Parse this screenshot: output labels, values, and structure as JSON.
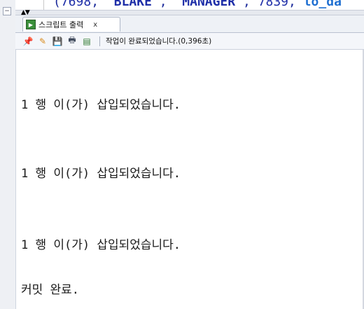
{
  "editor": {
    "code_open": "(",
    "code_num1": "7698",
    "code_str1": "'BLAKE'",
    "code_str2": "'MANAGER'",
    "code_num2": "7839",
    "code_kw": "to_da"
  },
  "splitter": {
    "arrows": "▲▼"
  },
  "tab": {
    "label": "스크립트 출력",
    "close": "x",
    "icon": "script-output-icon"
  },
  "toolbar": {
    "icons": [
      "pin-icon",
      "eraser-icon",
      "save-icon",
      "print-icon",
      "export-icon"
    ],
    "status": "작업이 완료되었습니다.(0,396초)"
  },
  "output": {
    "lines": [
      "1 행 이(가) 삽입되었습니다.",
      "1 행 이(가) 삽입되었습니다.",
      "1 행 이(가) 삽입되었습니다.",
      "커밋 완료."
    ]
  }
}
